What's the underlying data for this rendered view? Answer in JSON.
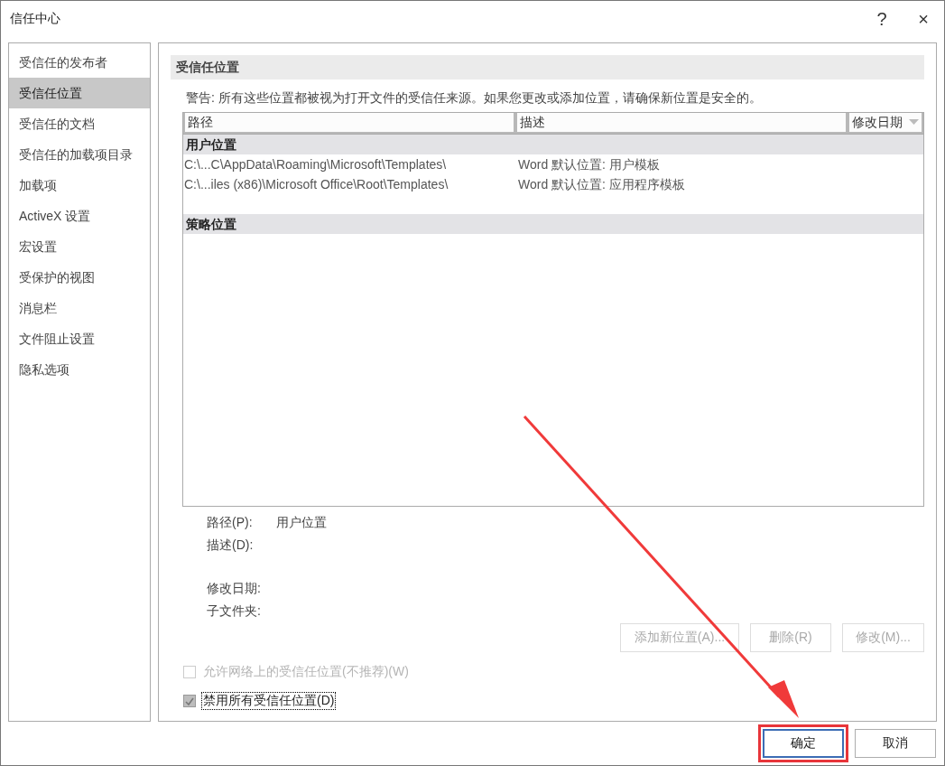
{
  "window": {
    "title": "信任中心",
    "help": "?",
    "close": "×"
  },
  "sidebar": {
    "items": [
      {
        "label": "受信任的发布者",
        "selected": false
      },
      {
        "label": "受信任位置",
        "selected": true
      },
      {
        "label": "受信任的文档",
        "selected": false
      },
      {
        "label": "受信任的加载项目录",
        "selected": false
      },
      {
        "label": "加载项",
        "selected": false
      },
      {
        "label": "ActiveX 设置",
        "selected": false
      },
      {
        "label": "宏设置",
        "selected": false
      },
      {
        "label": "受保护的视图",
        "selected": false
      },
      {
        "label": "消息栏",
        "selected": false
      },
      {
        "label": "文件阻止设置",
        "selected": false
      },
      {
        "label": "隐私选项",
        "selected": false
      }
    ]
  },
  "section": {
    "title": "受信任位置",
    "warning": "警告: 所有这些位置都被视为打开文件的受信任来源。如果您更改或添加位置，请确保新位置是安全的。"
  },
  "table": {
    "columns": [
      "路径",
      "描述",
      "修改日期"
    ],
    "rows": [
      {
        "kind": "group",
        "label": "用户位置"
      },
      {
        "kind": "item",
        "cells": [
          "C:\\...C\\AppData\\Roaming\\Microsoft\\Templates\\",
          "Word 默认位置: 用户模板"
        ]
      },
      {
        "kind": "item",
        "cells": [
          "C:\\...iles (x86)\\Microsoft Office\\Root\\Templates\\",
          "Word 默认位置: 应用程序模板"
        ]
      },
      {
        "kind": "spacer"
      },
      {
        "kind": "group",
        "label": "策略位置"
      }
    ]
  },
  "details": [
    {
      "label": "路径(P):",
      "value": "用户位置"
    },
    {
      "label": "描述(D):"
    },
    {
      "kind": "gap"
    },
    {
      "label": "修改日期:"
    },
    {
      "label": "子文件夹:"
    }
  ],
  "actions": [
    {
      "label": "添加新位置(A)...",
      "disabled": true
    },
    {
      "label": "删除(R)",
      "disabled": true
    },
    {
      "label": "修改(M)...",
      "disabled": true
    }
  ],
  "checkboxes": [
    {
      "label": "允许网络上的受信任位置(不推荐)(W)",
      "checked": false,
      "disabled": true,
      "focused": false
    },
    {
      "label": "禁用所有受信任位置(D)",
      "checked": true,
      "disabled": false,
      "focused": true
    }
  ],
  "buttons": [
    {
      "label": "确定",
      "default": true,
      "highlighted": true
    },
    {
      "label": "取消",
      "default": false,
      "highlighted": false
    }
  ]
}
